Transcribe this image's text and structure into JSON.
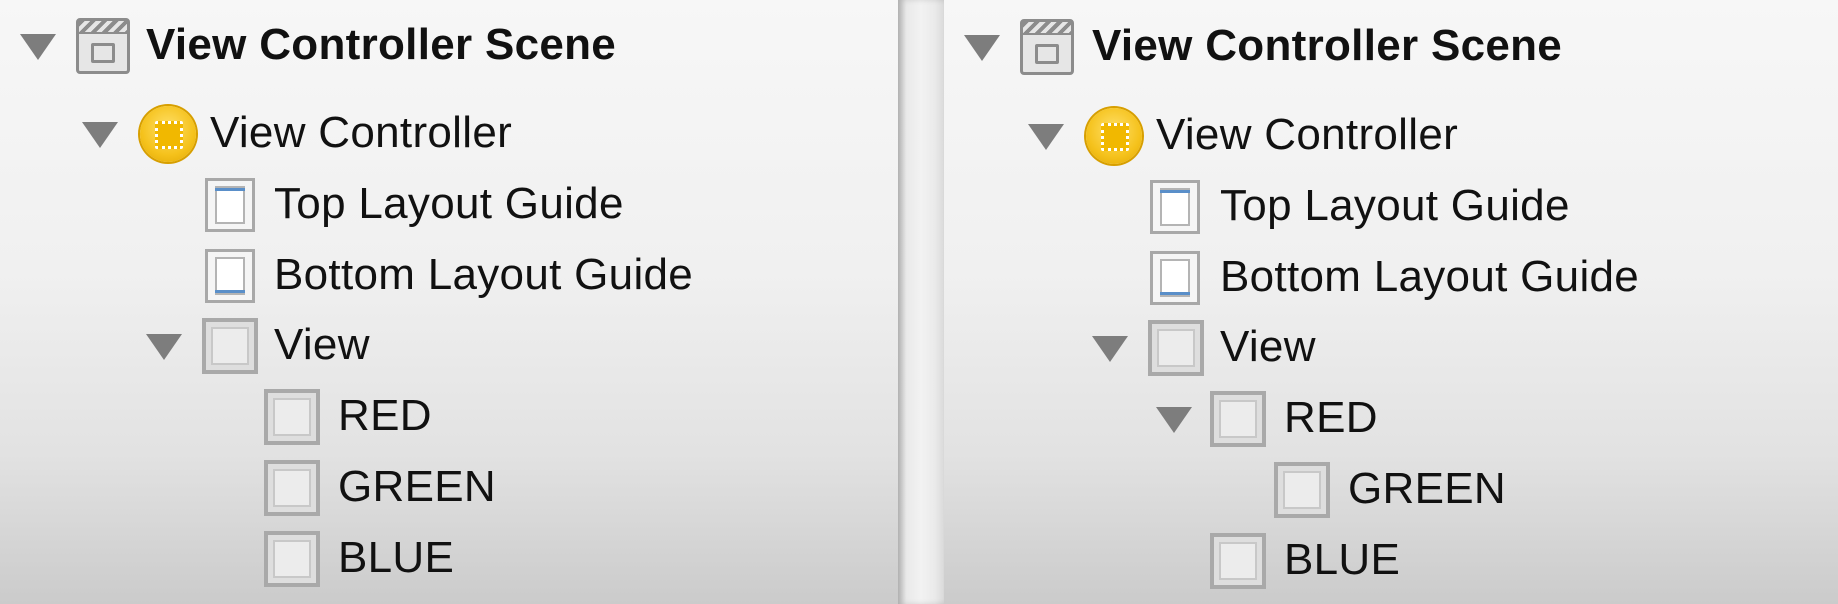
{
  "panels": [
    {
      "id": "left",
      "scene": {
        "label": "View Controller Scene",
        "icon": "storyboard-scene-icon",
        "expanded": true
      },
      "view_controller": {
        "label": "View Controller",
        "icon": "view-controller-icon",
        "expanded": true
      },
      "top_layout_guide": {
        "label": "Top Layout Guide",
        "icon": "top-layout-guide-icon"
      },
      "bottom_layout_guide": {
        "label": "Bottom Layout Guide",
        "icon": "bottom-layout-guide-icon"
      },
      "view": {
        "label": "View",
        "icon": "view-icon",
        "expanded": true
      },
      "subviews": [
        {
          "label": "RED",
          "icon": "view-icon",
          "depth": 0,
          "has_children": false
        },
        {
          "label": "GREEN",
          "icon": "view-icon",
          "depth": 0,
          "has_children": false
        },
        {
          "label": "BLUE",
          "icon": "view-icon",
          "depth": 0,
          "has_children": false
        }
      ]
    },
    {
      "id": "right",
      "scene": {
        "label": "View Controller Scene",
        "icon": "storyboard-scene-icon",
        "expanded": true
      },
      "view_controller": {
        "label": "View Controller",
        "icon": "view-controller-icon",
        "expanded": true
      },
      "top_layout_guide": {
        "label": "Top Layout Guide",
        "icon": "top-layout-guide-icon"
      },
      "bottom_layout_guide": {
        "label": "Bottom Layout Guide",
        "icon": "bottom-layout-guide-icon"
      },
      "view": {
        "label": "View",
        "icon": "view-icon",
        "expanded": true
      },
      "subviews": [
        {
          "label": "RED",
          "icon": "view-icon",
          "depth": 0,
          "has_children": true,
          "expanded": true
        },
        {
          "label": "GREEN",
          "icon": "view-icon",
          "depth": 1,
          "has_children": false
        },
        {
          "label": "BLUE",
          "icon": "view-icon",
          "depth": 0,
          "has_children": false
        }
      ]
    }
  ],
  "colors": {
    "view_controller_icon": "#f5c21c",
    "layout_guide_line": "#5a8fc9",
    "disclosure_triangle": "#7d7d7d"
  }
}
